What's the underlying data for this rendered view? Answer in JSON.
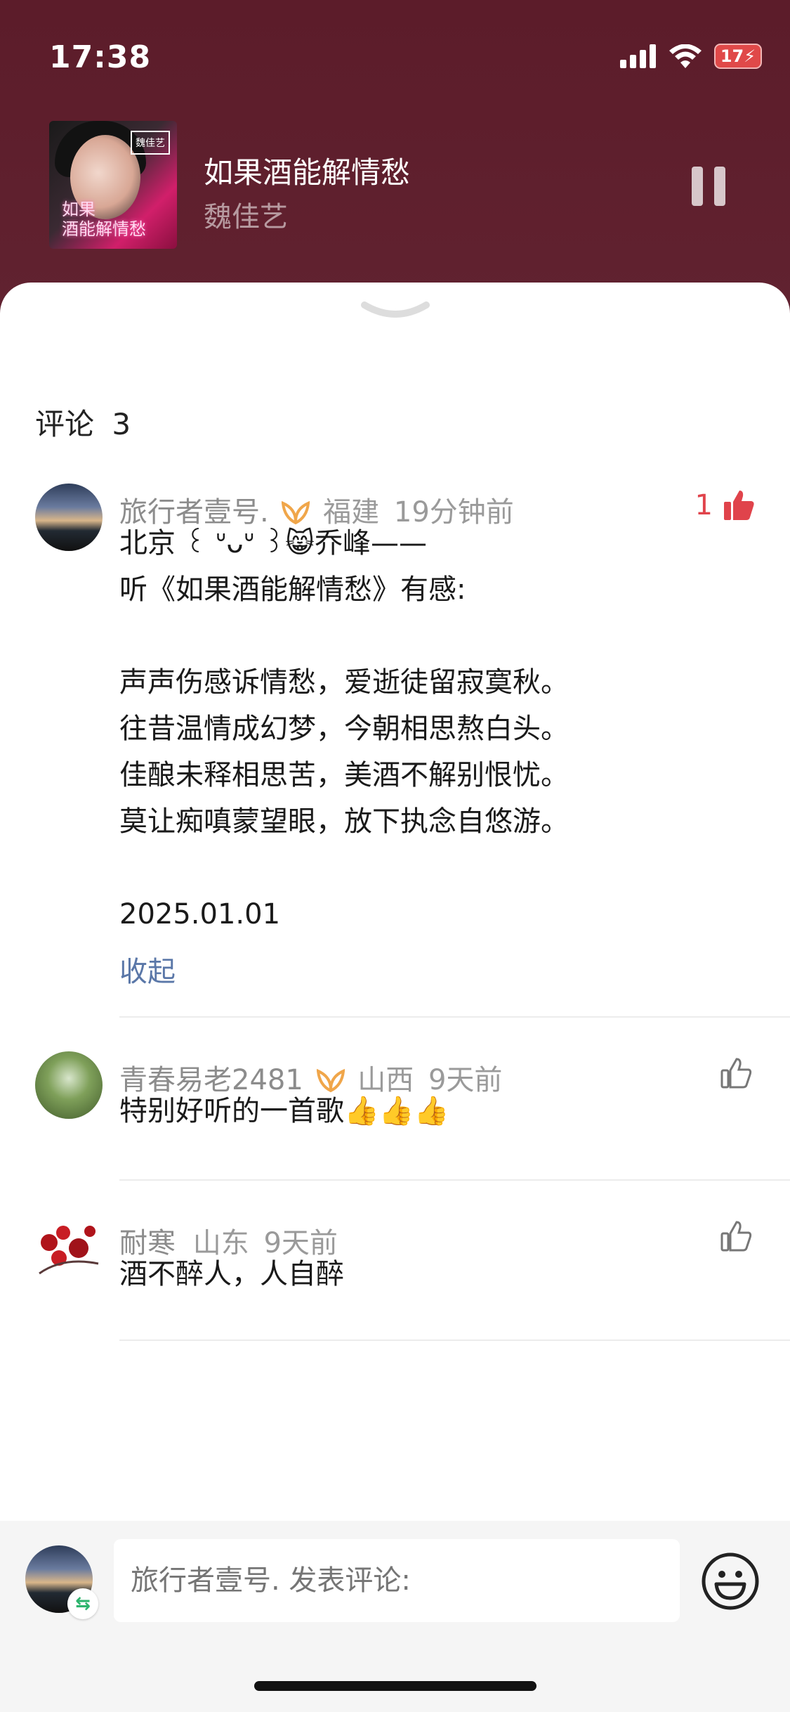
{
  "status_bar": {
    "time": "17:38",
    "battery": "17"
  },
  "now_playing": {
    "title": "如果酒能解情愁",
    "artist": "魏佳艺",
    "cover_text": "如果\n酒能解情愁",
    "cover_tag": "魏佳艺"
  },
  "comments_section": {
    "title": "评论",
    "count": "3",
    "comments": [
      {
        "user": "旅行者壹号.",
        "location": "福建",
        "time": "19分钟前",
        "likes": "1",
        "text": "北京 ꒰ ᐡᴗᐡ ꒱😸乔峰——\n听《如果酒能解情愁》有感:\n\n声声伤感诉情愁，爱逝徒留寂寞秋。\n往昔温情成幻梦，今朝相思熬白头。\n佳酿未释相思苦，美酒不解别恨忧。\n莫让痴嗔蒙望眼，放下执念自悠游。\n\n2025.01.01",
        "collapse_label": "收起"
      },
      {
        "user": "青春易老2481",
        "location": "山西",
        "time": "9天前",
        "text": "特别好听的一首歌👍👍👍"
      },
      {
        "user": "耐寒",
        "location": "山东",
        "time": "9天前",
        "text": "酒不醉人，人自醉"
      }
    ]
  },
  "composer": {
    "placeholder": "旅行者壹号. 发表评论:"
  }
}
